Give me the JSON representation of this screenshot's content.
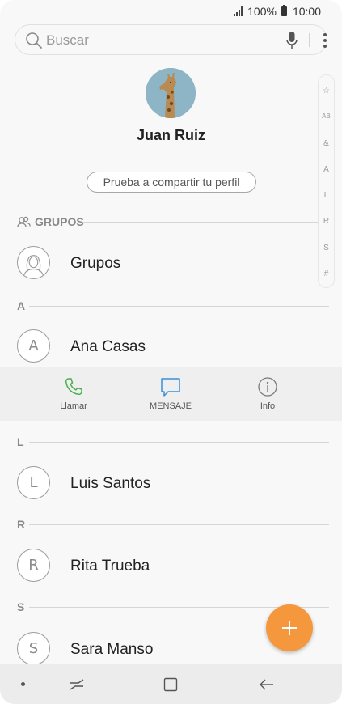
{
  "status_bar": {
    "battery_percent": "100%",
    "time": "10:00"
  },
  "search": {
    "placeholder": "Buscar"
  },
  "profile": {
    "name": "Juan Ruiz",
    "share_button": "Prueba a compartir tu perfil"
  },
  "index_letters": [
    "☆",
    "AB",
    "&",
    "A",
    "L",
    "R",
    "S",
    "#"
  ],
  "groups_header": "GRUPOS",
  "groups_item": "Grupos",
  "sections": [
    {
      "letter": "A",
      "contacts": [
        {
          "initial": "A",
          "name": "Ana Casas"
        }
      ]
    },
    {
      "letter": "L",
      "contacts": [
        {
          "initial": "L",
          "name": "Luis Santos"
        }
      ]
    },
    {
      "letter": "R",
      "contacts": [
        {
          "initial": "R",
          "name": "Rita Trueba"
        }
      ]
    },
    {
      "letter": "S",
      "contacts": [
        {
          "initial": "S",
          "name": "Sara Manso"
        }
      ]
    }
  ],
  "actions": {
    "call": "Llamar",
    "message": "MENSAJE",
    "info": "Info"
  },
  "colors": {
    "call_icon": "#4caf50",
    "message_icon": "#3b8fd9",
    "fab": "#f5973d"
  }
}
